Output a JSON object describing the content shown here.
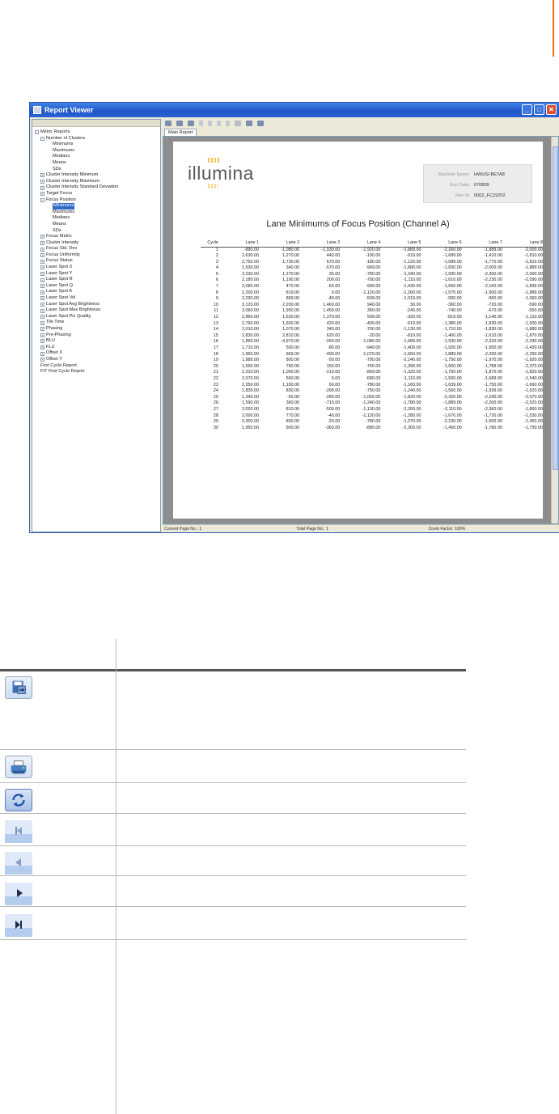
{
  "window": {
    "title": "Report Viewer",
    "tab": "Main Report",
    "status": {
      "current_page": "Current Page No.: 1",
      "total_page": "Total Page No.: 1",
      "zoom": "Zoom Factor: 100%"
    }
  },
  "tree": [
    {
      "label": "Metric Reports",
      "depth": 0,
      "toggle": "minus"
    },
    {
      "label": "Number of Clusters",
      "depth": 1,
      "toggle": "minus"
    },
    {
      "label": "Minimums",
      "depth": 2,
      "toggle": "none"
    },
    {
      "label": "Maximums",
      "depth": 2,
      "toggle": "none"
    },
    {
      "label": "Medians",
      "depth": 2,
      "toggle": "none"
    },
    {
      "label": "Means",
      "depth": 2,
      "toggle": "none"
    },
    {
      "label": "SDs",
      "depth": 2,
      "toggle": "none"
    },
    {
      "label": "Cluster Intensity Minimum",
      "depth": 1,
      "toggle": "plus"
    },
    {
      "label": "Cluster Intensity Maximum",
      "depth": 1,
      "toggle": "plus"
    },
    {
      "label": "Cluster Intensity Standard Deviation",
      "depth": 1,
      "toggle": "plus"
    },
    {
      "label": "Target Focus",
      "depth": 1,
      "toggle": "plus"
    },
    {
      "label": "Focus Position",
      "depth": 1,
      "toggle": "minus"
    },
    {
      "label": "Minimums",
      "depth": 2,
      "toggle": "none",
      "selected": true
    },
    {
      "label": "Maximums",
      "depth": 2,
      "toggle": "none"
    },
    {
      "label": "Medians",
      "depth": 2,
      "toggle": "none"
    },
    {
      "label": "Means",
      "depth": 2,
      "toggle": "none"
    },
    {
      "label": "SDs",
      "depth": 2,
      "toggle": "none"
    },
    {
      "label": "Focus Metric",
      "depth": 1,
      "toggle": "plus"
    },
    {
      "label": "Cluster Intensity",
      "depth": 1,
      "toggle": "plus"
    },
    {
      "label": "Focus Std. Dev",
      "depth": 1,
      "toggle": "plus"
    },
    {
      "label": "Focus Uniformity",
      "depth": 1,
      "toggle": "plus"
    },
    {
      "label": "Focus Status",
      "depth": 1,
      "toggle": "plus"
    },
    {
      "label": "Laser Spot X",
      "depth": 1,
      "toggle": "plus"
    },
    {
      "label": "Laser Spot Y",
      "depth": 1,
      "toggle": "plus"
    },
    {
      "label": "Laser Spot R",
      "depth": 1,
      "toggle": "plus"
    },
    {
      "label": "Laser Spot Q",
      "depth": 1,
      "toggle": "plus"
    },
    {
      "label": "Laser Spot A",
      "depth": 1,
      "toggle": "plus"
    },
    {
      "label": "Laser Spot Vol",
      "depth": 1,
      "toggle": "plus"
    },
    {
      "label": "Laser Spot Avg Brightness",
      "depth": 1,
      "toggle": "plus"
    },
    {
      "label": "Laser Spot Max Brightness",
      "depth": 1,
      "toggle": "plus"
    },
    {
      "label": "Laser Spot Pic Quality",
      "depth": 1,
      "toggle": "plus"
    },
    {
      "label": "Tile Time",
      "depth": 1,
      "toggle": "plus"
    },
    {
      "label": "Phasing",
      "depth": 1,
      "toggle": "plus"
    },
    {
      "label": "Pre-Phasing",
      "depth": 1,
      "toggle": "plus"
    },
    {
      "label": "BLU",
      "depth": 1,
      "toggle": "plus"
    },
    {
      "label": "FLU",
      "depth": 1,
      "toggle": "plus"
    },
    {
      "label": "Offset X",
      "depth": 1,
      "toggle": "plus"
    },
    {
      "label": "Offset Y",
      "depth": 1,
      "toggle": "plus"
    },
    {
      "label": "First Cycle Report",
      "depth": 0,
      "toggle": "none"
    },
    {
      "label": "FIT First Cycle Report",
      "depth": 0,
      "toggle": "none"
    }
  ],
  "report": {
    "logo_text": "illumina",
    "machine_name_label": "Machine Name:",
    "machine_name": "HWUSI-BETA8",
    "run_date_label": "Run Date:",
    "run_date": "070809",
    "run_id_label": "Run Id:",
    "run_id": "0002_FC19202",
    "title": "Lane Minimums of Focus Position (Channel A)",
    "columns": [
      "Cycle",
      "Lane 1",
      "Lane 2",
      "Lane 3",
      "Lane 4",
      "Lane 5",
      "Lane 6",
      "Lane 7",
      "Lane 8"
    ],
    "rows": [
      [
        "1",
        "-890.00",
        "-1,080.00",
        "-1,030.00",
        "-1,920.00",
        "-1,889.00",
        "-2,260.00",
        "-1,889.00",
        "-2,000.00"
      ],
      [
        "2",
        "2,630.00",
        "1,270.00",
        "440.00",
        "-190.00",
        "-919.00",
        "-1,689.00",
        "-1,410.00",
        "-1,810.00"
      ],
      [
        "3",
        "2,750.00",
        "1,730.00",
        "670.00",
        "-180.00",
        "-1,120.00",
        "-1,689.00",
        "-1,770.00",
        "-1,810.00"
      ],
      [
        "4",
        "1,530.00",
        "340.00",
        "-570.00",
        "-969.00",
        "-1,880.00",
        "-1,830.00",
        "-2,000.00",
        "-1,889.00"
      ],
      [
        "5",
        "2,230.00",
        "1,270.00",
        "30.00",
        "-780.00",
        "-1,340.00",
        "-1,930.00",
        "-2,300.00",
        "-2,000.00"
      ],
      [
        "6",
        "2,180.00",
        "1,190.00",
        "209.00",
        "-700.00",
        "-1,110.00",
        "-1,610.00",
        "-2,230.00",
        "-2,090.00"
      ],
      [
        "7",
        "2,080.00",
        "470.00",
        "-60.00",
        "-900.00",
        "-1,430.00",
        "-1,650.00",
        "-2,160.00",
        "-1,839.00"
      ],
      [
        "8",
        "2,200.00",
        "819.00",
        "0.00",
        "-1,120.00",
        "-1,260.00",
        "-1,570.00",
        "-1,900.00",
        "-1,889.00"
      ],
      [
        "9",
        "2,290.00",
        "869.00",
        "-40.00",
        "-509.00",
        "-1,019.00",
        "-930.00",
        "-960.00",
        "-1,060.00"
      ],
      [
        "10",
        "3,120.00",
        "2,200.00",
        "1,460.00",
        "940.00",
        "30.00",
        "-360.00",
        "-720.00",
        "-590.00"
      ],
      [
        "11",
        "3,060.00",
        "1,950.00",
        "1,459.00",
        "350.00",
        "-240.00",
        "-740.00",
        "-670.00",
        "-550.00"
      ],
      [
        "12",
        "2,860.00",
        "1,520.00",
        "1,370.00",
        "509.00",
        "-320.00",
        "-819.00",
        "-1,140.00",
        "-1,110.00"
      ],
      [
        "13",
        "2,760.00",
        "1,600.00",
        "420.00",
        "-400.00",
        "-919.00",
        "-1,380.00",
        "-1,830.00",
        "-1,500.00"
      ],
      [
        "14",
        "2,010.00",
        "1,070.00",
        "340.00",
        "-700.00",
        "-1,130.00",
        "-1,710.00",
        "-1,830.00",
        "-1,880.00"
      ],
      [
        "15",
        "2,830.00",
        "2,810.00",
        "620.00",
        "-20.00",
        "-819.00",
        "-1,460.00",
        "-1,610.00",
        "-1,870.00"
      ],
      [
        "16",
        "1,850.00",
        "-4,970.00",
        "-260.00",
        "-1,080.00",
        "-1,689.00",
        "-1,930.00",
        "-2,320.00",
        "-2,330.00"
      ],
      [
        "17",
        "1,710.00",
        "500.00",
        "-80.00",
        "-940.00",
        "-1,400.00",
        "-1,920.00",
        "-1,950.00",
        "-2,430.00"
      ],
      [
        "18",
        "1,960.00",
        "969.00",
        "-490.00",
        "-1,070.00",
        "-1,660.00",
        "-1,889.00",
        "-2,200.00",
        "-2,290.00"
      ],
      [
        "19",
        "1,989.00",
        "800.00",
        "-50.00",
        "-790.00",
        "-2,140.00",
        "-1,750.00",
        "-1,970.00",
        "-1,920.00"
      ],
      [
        "20",
        "1,650.00",
        "760.00",
        "150.00",
        "-760.00",
        "-1,390.00",
        "-1,600.00",
        "-1,789.00",
        "-2,370.00"
      ],
      [
        "21",
        "2,310.00",
        "1,000.00",
        "-210.00",
        "-869.00",
        "-1,320.00",
        "-1,750.00",
        "-1,870.00",
        "-1,820.00"
      ],
      [
        "22",
        "2,070.00",
        "560.00",
        "0.00",
        "-680.00",
        "-1,110.00",
        "-1,560.00",
        "-1,689.00",
        "-1,540.00"
      ],
      [
        "23",
        "2,350.00",
        "1,190.00",
        "60.00",
        "-780.00",
        "-1,160.00",
        "-1,639.00",
        "-1,750.00",
        "-1,660.00"
      ],
      [
        "24",
        "1,839.00",
        "830.00",
        "-299.00",
        "-750.00",
        "-1,240.00",
        "-1,560.00",
        "-1,939.00",
        "-1,620.00"
      ],
      [
        "25",
        "1,340.00",
        "-50.00",
        "-280.00",
        "-1,050.00",
        "-1,820.00",
        "-2,320.00",
        "-2,290.00",
        "-2,070.00"
      ],
      [
        "26",
        "1,590.00",
        "360.00",
        "-710.00",
        "-1,240.00",
        "-1,780.00",
        "-1,889.00",
        "-2,200.00",
        "-2,520.00"
      ],
      [
        "27",
        "2,020.00",
        "810.00",
        "-500.00",
        "-1,130.00",
        "-2,260.00",
        "-2,110.00",
        "-2,360.00",
        "-1,860.00"
      ],
      [
        "28",
        "2,000.00",
        "770.00",
        "-40.00",
        "-1,120.00",
        "-1,280.00",
        "-1,670.00",
        "-1,720.00",
        "-1,530.00"
      ],
      [
        "29",
        "2,300.00",
        "800.00",
        "-20.00",
        "-780.00",
        "-1,370.00",
        "-2,230.00",
        "-1,500.00",
        "-1,450.00"
      ],
      [
        "30",
        "1,950.00",
        "900.00",
        "-360.00",
        "-880.00",
        "-2,360.00",
        "-1,450.00",
        "-1,780.00",
        "-1,730.00"
      ]
    ]
  },
  "doc_rows": [
    {
      "icon": "save-icon",
      "kind": "save"
    },
    {
      "icon": "print-icon",
      "kind": "print"
    },
    {
      "icon": "refresh-icon",
      "kind": "refresh"
    },
    {
      "icon": "first-page-icon",
      "kind": "first"
    },
    {
      "icon": "previous-page-icon",
      "kind": "prev"
    },
    {
      "icon": "next-page-icon",
      "kind": "next"
    },
    {
      "icon": "last-page-icon",
      "kind": "last"
    }
  ]
}
